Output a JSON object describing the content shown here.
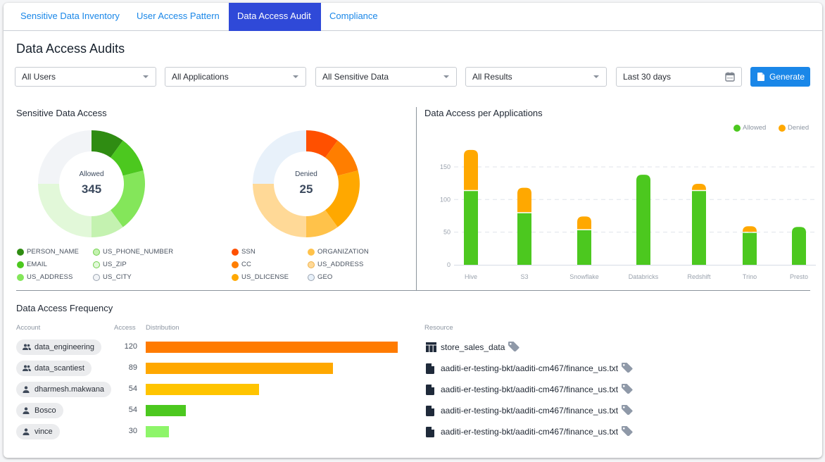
{
  "tabs": [
    {
      "label": "Sensitive Data Inventory",
      "active": false
    },
    {
      "label": "User Access Pattern",
      "active": false
    },
    {
      "label": "Data Access Audit",
      "active": true
    },
    {
      "label": "Compliance",
      "active": false
    }
  ],
  "page_title": "Data Access Audits",
  "filters": {
    "users": "All Users",
    "applications": "All Applications",
    "sensitive_data": "All Sensitive Data",
    "results": "All Results",
    "date_range": "Last 30 days",
    "generate_label": "Generate"
  },
  "colors": {
    "accent": "#1a87e8",
    "active_tab": "#2f49d8",
    "allowed": "#4cc81f",
    "denied": "#ffa800"
  },
  "sensitive_data_access": {
    "title": "Sensitive Data Access",
    "allowed": {
      "label": "Allowed",
      "total": "345",
      "segments": [
        {
          "name": "PERSON_NAME",
          "fraction": 0.1,
          "color": "#2f8c12"
        },
        {
          "name": "EMAIL",
          "fraction": 0.11,
          "color": "#4cc81f"
        },
        {
          "name": "US_ADDRESS",
          "fraction": 0.19,
          "color": "#84e65a"
        },
        {
          "name": "US_PHONE_NUMBER",
          "fraction": 0.1,
          "color": "#c4f2b0"
        },
        {
          "name": "US_ZIP",
          "fraction": 0.25,
          "color": "#e2f8d9"
        },
        {
          "name": "US_CITY",
          "fraction": 0.25,
          "color": "#f2f4f7"
        }
      ]
    },
    "denied": {
      "label": "Denied",
      "total": "25",
      "segments": [
        {
          "name": "SSN",
          "fraction": 0.1,
          "color": "#ff5000"
        },
        {
          "name": "CC",
          "fraction": 0.11,
          "color": "#ff7e00"
        },
        {
          "name": "US_DLICENSE",
          "fraction": 0.19,
          "color": "#ffa800"
        },
        {
          "name": "ORGANIZATION",
          "fraction": 0.1,
          "color": "#ffc24a"
        },
        {
          "name": "US_ADDRESS",
          "fraction": 0.25,
          "color": "#ffd997"
        },
        {
          "name": "GEO",
          "fraction": 0.25,
          "color": "#e8f1fa"
        }
      ]
    }
  },
  "chart_data": {
    "type": "bar",
    "title": "Data Access per Applications",
    "stacked": true,
    "categories": [
      "Hive",
      "S3",
      "Snowflake",
      "Databricks",
      "Redshift",
      "Trino",
      "Presto"
    ],
    "series": [
      {
        "name": "Allowed",
        "color": "#4cc81f",
        "values": [
          113,
          79,
          53,
          138,
          113,
          49,
          58
        ]
      },
      {
        "name": "Denied",
        "color": "#ffa800",
        "values": [
          63,
          39,
          21,
          0,
          11,
          10,
          0
        ]
      }
    ],
    "yticks": [
      "0",
      "50",
      "100",
      "150"
    ],
    "ylim": [
      0,
      175
    ],
    "grid": true,
    "legend": "top-right",
    "xlabel": "",
    "ylabel": ""
  },
  "frequency": {
    "title": "Data Access Frequency",
    "headers": {
      "account": "Account",
      "access": "Access",
      "distribution": "Distribution",
      "resource": "Resource"
    },
    "max": 120,
    "rows": [
      {
        "account": "data_engineering",
        "type": "group",
        "access": "120",
        "value": 120,
        "color": "#ff7b00",
        "resource": "store_sales_data",
        "resource_type": "table"
      },
      {
        "account": "data_scantiest",
        "type": "group",
        "access": "89",
        "value": 89,
        "color": "#ffa800",
        "resource": "aaditi-er-testing-bkt/aaditi-cm467/finance_us.txt",
        "resource_type": "file"
      },
      {
        "account": "dharmesh.makwana",
        "type": "user",
        "access": "54",
        "value": 54,
        "color": "#ffc400",
        "resource": "aaditi-er-testing-bkt/aaditi-cm467/finance_us.txt",
        "resource_type": "file"
      },
      {
        "account": "Bosco",
        "type": "user",
        "access": "54",
        "value": 19,
        "color": "#4cc81f",
        "resource": "aaditi-er-testing-bkt/aaditi-cm467/finance_us.txt",
        "resource_type": "file"
      },
      {
        "account": "vince",
        "type": "user",
        "access": "30",
        "value": 11,
        "color": "#8ef56a",
        "resource": "aaditi-er-testing-bkt/aaditi-cm467/finance_us.txt",
        "resource_type": "file"
      }
    ]
  }
}
